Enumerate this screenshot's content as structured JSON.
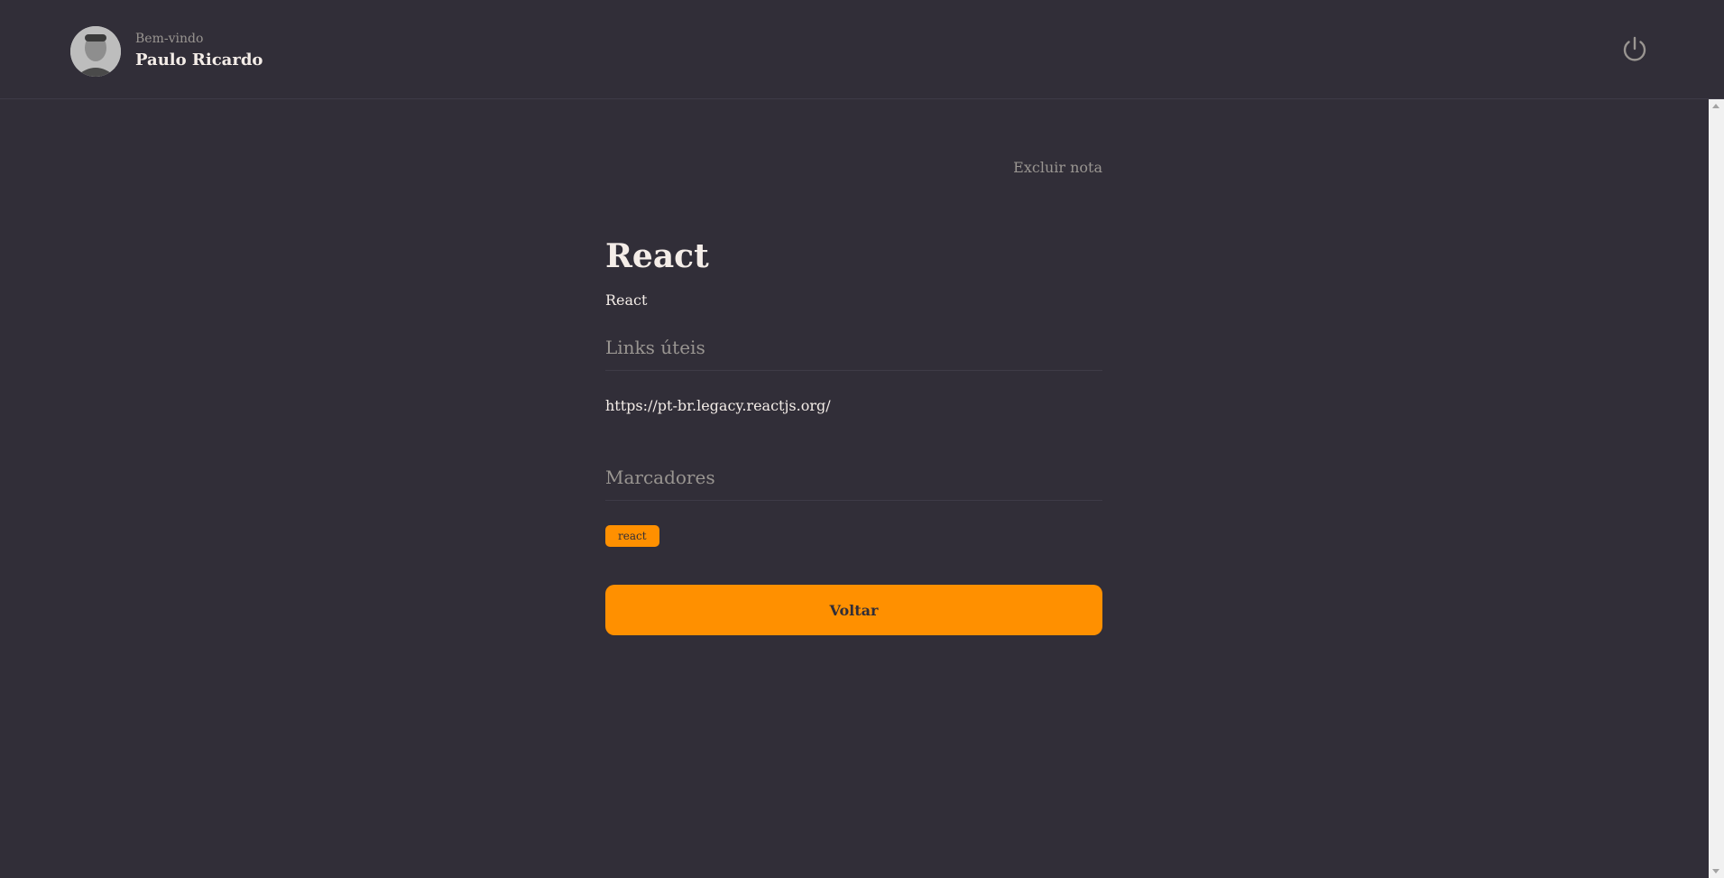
{
  "header": {
    "welcome": "Bem-vindo",
    "username": "Paulo Ricardo",
    "logout_icon": "power-icon"
  },
  "note": {
    "delete_label": "Excluir nota",
    "title": "React",
    "description": "React",
    "links_section_title": "Links úteis",
    "links": [
      "https://pt-br.legacy.reactjs.org/"
    ],
    "tags_section_title": "Marcadores",
    "tags": [
      "react"
    ],
    "back_label": "Voltar"
  },
  "colors": {
    "background": "#312E38",
    "accent": "#FF9000",
    "text": "#F4EDE8",
    "muted": "#999591"
  }
}
